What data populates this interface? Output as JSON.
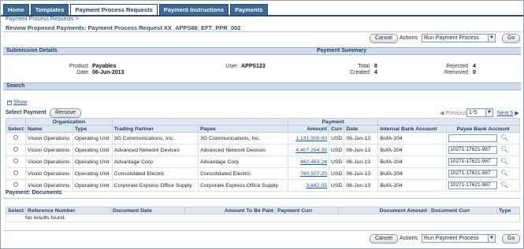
{
  "tabs": [
    "Home",
    "Templates",
    "Payment Process Requests",
    "Payment Instructions",
    "Payments"
  ],
  "breadcrumb": "Payment Process Requests  >",
  "page_title": "Review Proposed Payments: Payment Process Request XX_APPS88_EFT_PPR_002",
  "actions": {
    "cancel_label": "Cancel",
    "actions_label": "Actions",
    "selected_action": "Run Payment Process",
    "go_label": "Go"
  },
  "submission": {
    "heading": "Submission Details",
    "product_label": "Product",
    "product_value": "Payables",
    "date_label": "Date",
    "date_value": "06-Jun-2013",
    "user_label": "User",
    "user_value": "APPS123"
  },
  "summary": {
    "heading": "Payment Summary",
    "total_label": "Total",
    "total_value": "8",
    "created_label": "Created",
    "created_value": "4",
    "rejected_label": "Rejected",
    "rejected_value": "4",
    "removed_label": "Removed",
    "removed_value": "0"
  },
  "search": {
    "heading": "Search",
    "show_label": "Show"
  },
  "select_payment": {
    "label": "Select Payment",
    "remove_label": "Remove",
    "previous_label": "Previous",
    "range": "1-5",
    "next_label": "Next 5"
  },
  "payments_table": {
    "group_headers": {
      "organization": "Organization",
      "payment": "Payment"
    },
    "columns": [
      "Select",
      "Name",
      "Type",
      "Trading Partner",
      "Payee",
      "Amount",
      "Curr",
      "Date",
      "Internal Bank Account",
      "Payee Bank Account"
    ],
    "rows": [
      {
        "name": "Vision Operations",
        "type": "Operating Unit",
        "partner": "3G Communications, Inc.",
        "payee": "3G Communications, Inc.",
        "amount": "1,131,900.00",
        "curr": "USD",
        "date": "06-Jun-13",
        "internal": "BofA-204",
        "payee_bank": ""
      },
      {
        "name": "Vision Operations",
        "type": "Operating Unit",
        "partner": "Advanced Network Devices",
        "payee": "Advanced Network Devices",
        "amount": "4,407,294.35",
        "curr": "USD",
        "date": "06-Jun-13",
        "internal": "BofA-204",
        "payee_bank": "10271-17621-987"
      },
      {
        "name": "Vision Operations",
        "type": "Operating Unit",
        "partner": "Advantage Corp",
        "payee": "Advantage Corp",
        "amount": "462,463.24",
        "curr": "USD",
        "date": "06-Jun-13",
        "internal": "BofA-204",
        "payee_bank": "10271-17621-987"
      },
      {
        "name": "Vision Operations",
        "type": "Operating Unit",
        "partner": "Consolidated Electric",
        "payee": "Consolidated Electric",
        "amount": "760,507.20",
        "curr": "USD",
        "date": "06-Jun-13",
        "internal": "BofA-204",
        "payee_bank": "10271-17621-987"
      },
      {
        "name": "Vision Operations",
        "type": "Operating Unit",
        "partner": "Corporate Express Office Supply",
        "payee": "Corporate Express Office Supply",
        "amount": "3,642.05",
        "curr": "USD",
        "date": "06-Jun-13",
        "internal": "BofA-204",
        "payee_bank": "10271-17621-987"
      }
    ]
  },
  "documents": {
    "heading": "Payment: Documents",
    "columns": [
      "Select",
      "Reference Number",
      "Document Date",
      "Amount To Be Paid",
      "Payment Curr",
      "Document Amount",
      "Document Curr",
      "Type"
    ],
    "empty_text": "No results found."
  },
  "colors": {
    "tab_bg": "#3c6796",
    "section_bg": "#cfdbe9",
    "link": "#2257a3"
  }
}
